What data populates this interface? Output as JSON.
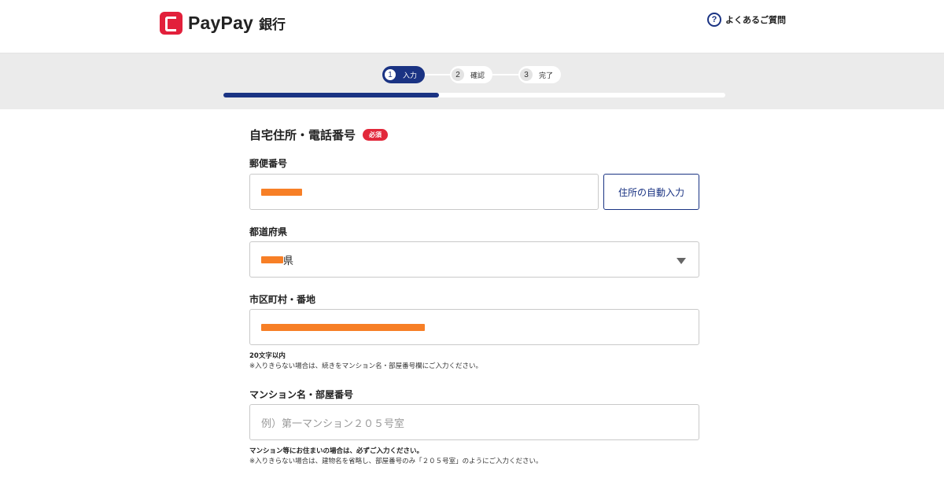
{
  "header": {
    "brand": "PayPay",
    "brand_sub": "銀行",
    "faq_icon": "question-circle-icon",
    "faq_label": "よくあるご質問"
  },
  "steps": {
    "items": [
      {
        "number": "1",
        "label": "入力",
        "state": "active"
      },
      {
        "number": "2",
        "label": "確認",
        "state": "inactive"
      },
      {
        "number": "3",
        "label": "完了",
        "state": "inactive"
      }
    ],
    "progress": 0.43
  },
  "form": {
    "section_title": "自宅住所・電話番号",
    "required_badge": "必須",
    "postal": {
      "label": "郵便番号",
      "value": "",
      "auto_fill_button": "住所の自動入力"
    },
    "prefecture": {
      "label": "都道府県",
      "value_suffix": "県"
    },
    "city": {
      "label": "市区町村・番地",
      "note_limit": "20文字以内",
      "note_hint": "※入りきらない場合は、続きをマンション名・部屋番号欄にご入力ください。"
    },
    "building": {
      "label": "マンション名・部屋番号",
      "placeholder": "例）第一マンション２０５号室",
      "note_bold": "マンション等にお住まいの場合は、必ずご入力ください。",
      "note_hint": "※入りきらない場合は、建物名を省略し、部屋番号のみ「２０５号室」のようにご入力ください。"
    }
  },
  "colors": {
    "brand_red": "#e2203b",
    "accent_navy": "#1a3383",
    "redaction_orange": "#f77f26"
  }
}
